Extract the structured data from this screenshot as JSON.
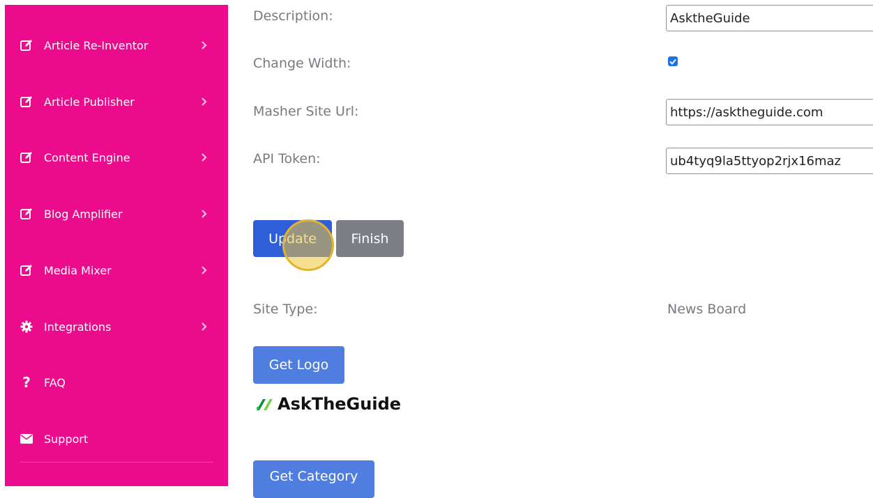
{
  "sidebar": {
    "items": [
      {
        "label": "Article Re-Inventor",
        "icon": "edit-icon"
      },
      {
        "label": "Article Publisher",
        "icon": "edit-icon"
      },
      {
        "label": "Content Engine",
        "icon": "edit-icon"
      },
      {
        "label": "Blog Amplifier",
        "icon": "edit-icon"
      },
      {
        "label": "Media Mixer",
        "icon": "edit-icon"
      },
      {
        "label": "Integrations",
        "icon": "gear-icon"
      },
      {
        "label": "FAQ",
        "icon": "question-icon"
      },
      {
        "label": "Support",
        "icon": "envelope-icon"
      }
    ],
    "accent_color": "#ec0b8c"
  },
  "form": {
    "description_label": "Description:",
    "description_value": "AsktheGuide",
    "change_width_label": "Change Width:",
    "change_width_checked": true,
    "masher_url_label": "Masher Site Url:",
    "masher_url_value": "https://asktheguide.com",
    "api_token_label": "API Token:",
    "api_token_value": "ub4tyq9la5ttyop2rjx16maz",
    "update_label": "Update",
    "finish_label": "Finish",
    "site_type_label": "Site Type:",
    "site_type_value": "News Board",
    "get_logo_label": "Get Logo",
    "logo_text": "AskTheGuide",
    "get_category_label": "Get Category"
  }
}
